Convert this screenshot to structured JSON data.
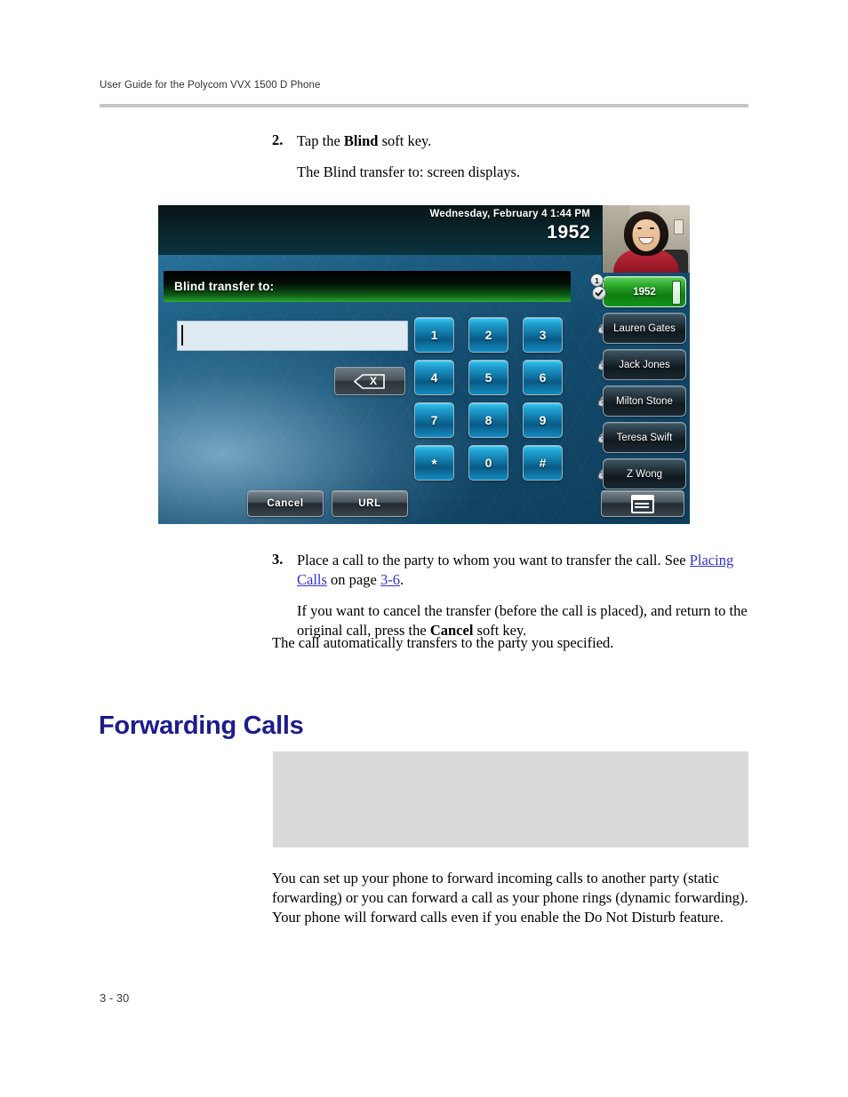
{
  "page": {
    "header_text": "User Guide for the Polycom VVX 1500 D Phone",
    "footer_text": "3 - 30"
  },
  "steps": [
    {
      "number": "2.",
      "line1_prefix": "Tap the ",
      "line1_bold": "Blind",
      "line1_suffix": " soft key.",
      "line2": "The Blind transfer to: screen displays."
    },
    {
      "number": "3.",
      "line1_prefix": "Place a call to the party to whom you want to transfer the call. See ",
      "link_text": "Placing Calls",
      "line1_mid": " on page ",
      "link_page": "3-6",
      "line1_suffix": ".",
      "line2_prefix": "If you want to cancel the transfer (before the call is placed), and return to the original call, press the ",
      "line2_bold": "Cancel",
      "line2_suffix": " soft key."
    }
  ],
  "after_step3": "The call automatically transfers to the party you specified.",
  "section": {
    "heading": "Forwarding Calls",
    "body": "You can set up your phone to forward incoming calls to another party (static forwarding) or you can forward a call as your phone rings (dynamic forwarding). Your phone will forward calls even if you enable the Do Not Disturb feature."
  },
  "phone": {
    "status": {
      "date_time": "Wednesday, February 4  1:44 PM",
      "extension": "1952"
    },
    "title_bar": "Blind transfer to:",
    "entry_value": "",
    "backspace_label": "X",
    "dialpad_keys": [
      "1",
      "2",
      "3",
      "4",
      "5",
      "6",
      "7",
      "8",
      "9",
      "*",
      "0",
      "#"
    ],
    "line_keys": [
      {
        "label": "1952",
        "active": true,
        "badge": "1"
      },
      {
        "label": "Lauren Gates",
        "active": false
      },
      {
        "label": "Jack Jones",
        "active": false
      },
      {
        "label": "Milton Stone",
        "active": false
      },
      {
        "label": "Teresa Swift",
        "active": false
      },
      {
        "label": "Z Wong",
        "active": false
      }
    ],
    "softkeys": {
      "cancel": "Cancel",
      "url": "URL"
    },
    "colors": {
      "active_line_green": "#2aa632",
      "screen_blue": "#1d5d82",
      "heading_navy": "#1c1c8c",
      "link_blue": "#3333cc"
    }
  }
}
